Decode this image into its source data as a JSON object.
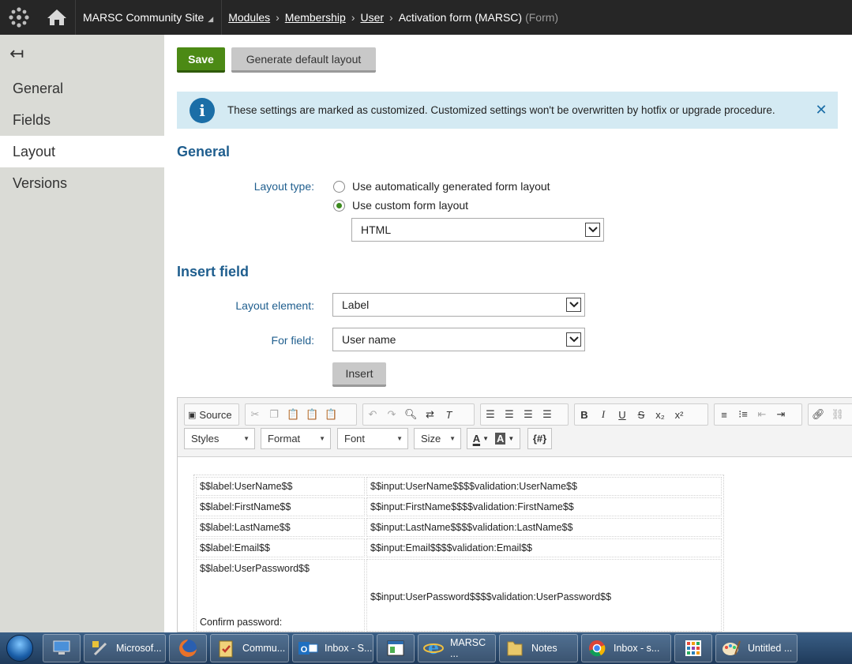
{
  "topbar": {
    "site": "MARSC Community Site",
    "breadcrumbs": [
      "Modules",
      "Membership",
      "User"
    ],
    "current": "Activation form (MARSC)",
    "current_suffix": "(Form)"
  },
  "nav": {
    "back_glyph": "↤",
    "items": [
      "General",
      "Fields",
      "Layout",
      "Versions"
    ],
    "active": "Layout"
  },
  "actions": {
    "save": "Save",
    "generate": "Generate default layout"
  },
  "info": {
    "icon": "i",
    "text": "These settings are marked as customized. Customized settings won't be overwritten by hotfix or upgrade procedure.",
    "close": "✕"
  },
  "general": {
    "heading": "General",
    "layout_type_label": "Layout type:",
    "option_auto": "Use automatically generated form layout",
    "option_custom": "Use custom form layout",
    "selected": "custom",
    "format_value": "HTML"
  },
  "insert": {
    "heading": "Insert field",
    "element_label": "Layout element:",
    "element_value": "Label",
    "field_label": "For field:",
    "field_value": "User name",
    "button": "Insert"
  },
  "editor": {
    "source_label": "Source",
    "styles": "Styles",
    "format": "Format",
    "font": "Font",
    "size": "Size",
    "placeholder_btn": "{#}",
    "rows": [
      {
        "label": "$$label:UserName$$",
        "input": "$$input:UserName$$$$validation:UserName$$"
      },
      {
        "label": "$$label:FirstName$$",
        "input": "$$input:FirstName$$$$validation:FirstName$$"
      },
      {
        "label": "$$label:LastName$$",
        "input": "$$input:LastName$$$$validation:LastName$$"
      },
      {
        "label": "$$label:Email$$",
        "input": "$$input:Email$$$$validation:Email$$"
      }
    ],
    "password_label": "$$label:UserPassword$$",
    "password_input": "$$input:UserPassword$$$$validation:UserPassword$$",
    "confirm_label": "Confirm password:"
  },
  "taskbar": {
    "items": [
      {
        "label": "Microsof...",
        "icon": "tools-icon"
      },
      {
        "label": "Commu...",
        "icon": "clipboard-icon"
      },
      {
        "label": "Inbox - S...",
        "icon": "outlook-icon"
      },
      {
        "label": "MARSC ...",
        "icon": "ie-icon"
      },
      {
        "label": "Notes",
        "icon": "folder-icon"
      },
      {
        "label": "Inbox - s...",
        "icon": "chrome-icon"
      },
      {
        "label": "Untitled ...",
        "icon": "paint-icon"
      }
    ]
  }
}
